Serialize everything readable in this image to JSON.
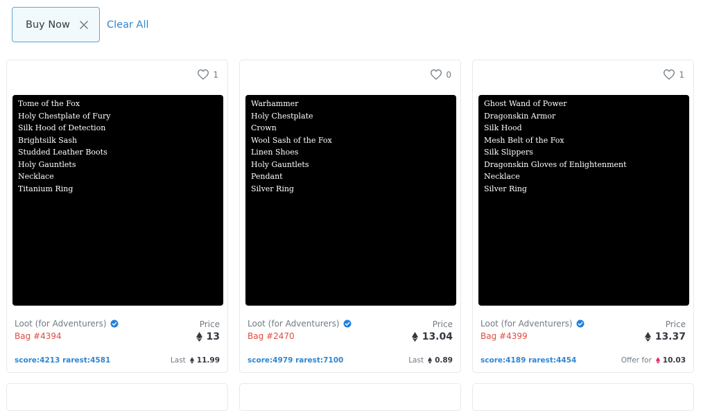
{
  "filters": {
    "active_chip": "Buy Now",
    "clear_all": "Clear All"
  },
  "colors": {
    "accent": "#2f86d1",
    "bag_name": "#e04a3f",
    "weth": "#e0245e"
  },
  "cards": [
    {
      "favorites": "1",
      "items": [
        "Tome of the Fox",
        "Holy Chestplate of Fury",
        "Silk Hood of Detection",
        "Brightsilk Sash",
        "Studded Leather Boots",
        "Holy Gauntlets",
        "Necklace",
        "Titanium Ring"
      ],
      "collection": "Loot (for Adventurers)",
      "name": "Bag #4394",
      "price_label": "Price",
      "price": "13",
      "score": "score:4213 rarest:4581",
      "last_label": "Last",
      "last_value": "11.99",
      "last_currency_icon": "eth-icon"
    },
    {
      "favorites": "0",
      "items": [
        "Warhammer",
        "Holy Chestplate",
        "Crown",
        "Wool Sash of the Fox",
        "Linen Shoes",
        "Holy Gauntlets",
        "Pendant",
        "Silver Ring"
      ],
      "collection": "Loot (for Adventurers)",
      "name": "Bag #2470",
      "price_label": "Price",
      "price": "13.04",
      "score": "score:4979 rarest:7100",
      "last_label": "Last",
      "last_value": "0.89",
      "last_currency_icon": "eth-icon"
    },
    {
      "favorites": "1",
      "items": [
        "Ghost Wand of Power",
        "Dragonskin Armor",
        "Silk Hood",
        "Mesh Belt of the Fox",
        "Silk Slippers",
        "Dragonskin Gloves of Enlightenment",
        "Necklace",
        "Silver Ring"
      ],
      "collection": "Loot (for Adventurers)",
      "name": "Bag #4399",
      "price_label": "Price",
      "price": "13.37",
      "score": "score:4189 rarest:4454",
      "last_label": "Offer for",
      "last_value": "10.03",
      "last_currency_icon": "weth-icon"
    }
  ]
}
